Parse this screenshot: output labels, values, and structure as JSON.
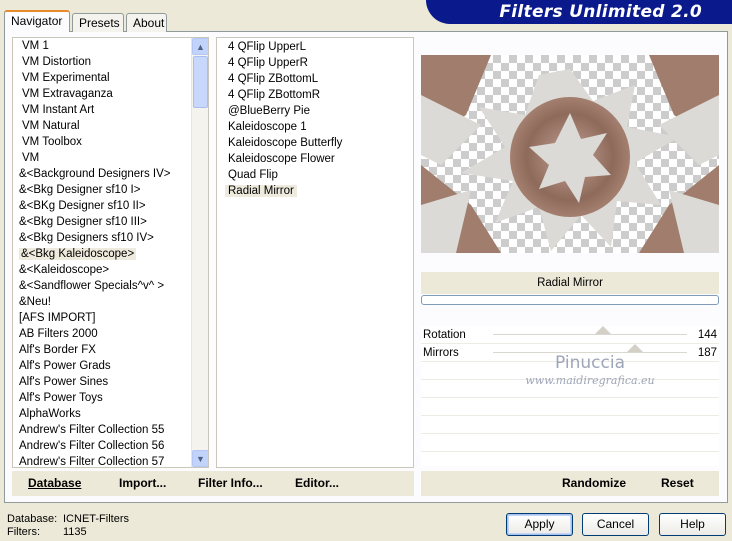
{
  "tabs": [
    {
      "label": "Navigator",
      "active": true
    },
    {
      "label": "Presets",
      "active": false
    },
    {
      "label": "About",
      "active": false
    }
  ],
  "banner_title": "Filters Unlimited 2.0",
  "categories": [
    "VM 1",
    "VM Distortion",
    "VM Experimental",
    "VM Extravaganza",
    "VM Instant Art",
    "VM Natural",
    "VM Toolbox",
    "VM",
    "&<Background Designers IV>",
    "&<Bkg Designer sf10 I>",
    "&<BKg Designer sf10 II>",
    "&<Bkg Designer sf10 III>",
    "&<Bkg Designers sf10 IV>",
    "&<Bkg Kaleidoscope>",
    "&<Kaleidoscope>",
    "&<Sandflower Specials^v^ >",
    "&Neu!",
    "[AFS IMPORT]",
    "AB Filters 2000",
    "Alf's Border FX",
    "Alf's Power Grads",
    "Alf's Power Sines",
    "Alf's Power Toys",
    "AlphaWorks",
    "Andrew's Filter Collection 55",
    "Andrew's Filter Collection 56",
    "Andrew's Filter Collection 57"
  ],
  "selected_category": "&<Bkg Kaleidoscope>",
  "filters": [
    "4 QFlip UpperL",
    "4 QFlip UpperR",
    "4 QFlip ZBottomL",
    "4 QFlip ZBottomR",
    "@BlueBerry Pie",
    "Kaleidoscope 1",
    "Kaleidoscope Butterfly",
    "Kaleidoscope Flower",
    "Quad Flip",
    "Radial Mirror"
  ],
  "selected_filter": "Radial Mirror",
  "preview_filter_name": "Radial Mirror",
  "progress": 0,
  "params": [
    {
      "label": "Rotation",
      "value": "144",
      "fraction": 0.565
    },
    {
      "label": "Mirrors",
      "value": "187",
      "fraction": 0.733
    }
  ],
  "watermark": {
    "line1": "Pinuccia",
    "line2": "www.maidiregrafica.eu"
  },
  "toolbar": {
    "database": "Database",
    "import": "Import...",
    "filter_info": "Filter Info...",
    "editor": "Editor...",
    "randomize": "Randomize",
    "reset": "Reset"
  },
  "status": {
    "database_label": "Database:",
    "database_value": "ICNET-Filters",
    "filters_label": "Filters:",
    "filters_value": "1135"
  },
  "buttons": {
    "apply": "Apply",
    "cancel": "Cancel",
    "help": "Help"
  },
  "colors": {
    "banner_bg": "#0a1a8c",
    "banner_text": "#ffffff",
    "selection": "#eeeadd",
    "preview_tan": "#a07d6c",
    "preview_light": "#dcdad6"
  }
}
